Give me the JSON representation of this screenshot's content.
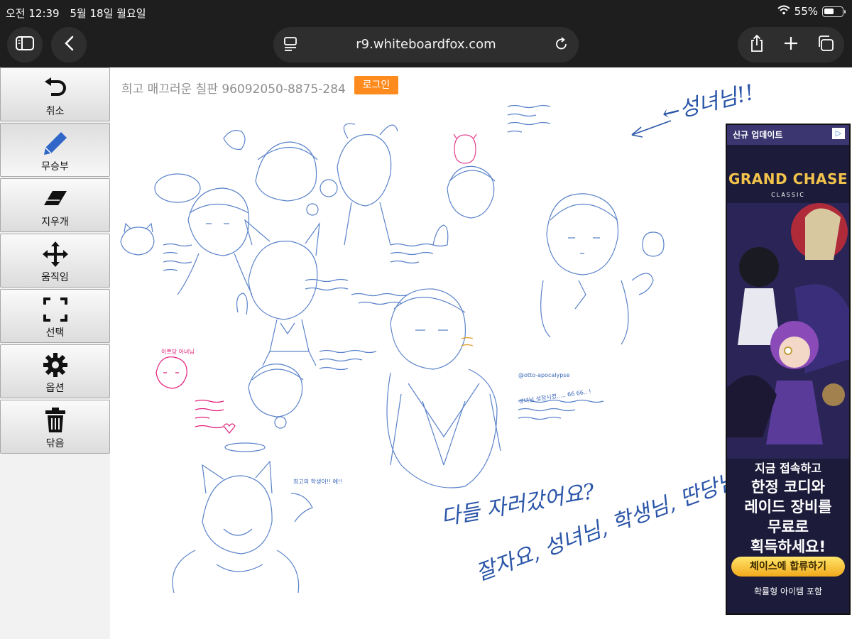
{
  "status_bar": {
    "time": "오전 12:39",
    "date": "5월 18일 월요일",
    "battery_text": "55%",
    "battery_level": 0.55
  },
  "browser": {
    "url": "r9.whiteboardfox.com",
    "icons": {
      "sidebar": "sidebar-icon",
      "back": "chevron-left-icon",
      "reader": "reader-icon",
      "reload": "reload-icon",
      "share": "share-icon",
      "new_tab": "plus-icon",
      "tabs": "tabs-icon"
    }
  },
  "toolbar": {
    "items": [
      {
        "label": "취소",
        "icon": "undo-icon"
      },
      {
        "label": "무승부",
        "icon": "pencil-icon",
        "active": true
      },
      {
        "label": "지우개",
        "icon": "eraser-icon"
      },
      {
        "label": "움직임",
        "icon": "move-icon"
      },
      {
        "label": "선택",
        "icon": "select-icon"
      },
      {
        "label": "옵션",
        "icon": "gear-icon"
      },
      {
        "label": "닦음",
        "icon": "trash-icon"
      }
    ]
  },
  "board": {
    "title": "희고 매끄러운 칠판 96092050-8875-284",
    "login_label": "로그인",
    "handwriting": {
      "top_right": "←성녀님!!",
      "big_line1": "다들 자러갔어요?",
      "big_line2": "잘자요, 성녀님, 학생님, 딴당님",
      "sign_tag": "@otto-apocalypse",
      "note_a": "성녀님 성장시켰..... 66 66.. !",
      "note_b": "이쁘당 아녀님",
      "note_c": "최고의 학생이!! 예!!"
    },
    "colors": {
      "ink_blue": "#2a55a8",
      "ink_pink": "#e0207a",
      "ink_orange": "#e09a20"
    }
  },
  "ad": {
    "badge": "신규 업데이트",
    "choices_icon": "adchoices-icon",
    "logo": "GRAND CHASE",
    "logo_sub": "CLASSIC",
    "line1": "지금 접속하고",
    "line2": "한정 코디와",
    "line3": "레이드 장비를",
    "line4": "무료로",
    "line5": "획득하세요!",
    "cta": "체이스에 합류하기",
    "footer": "확률형 아이템 포함"
  }
}
